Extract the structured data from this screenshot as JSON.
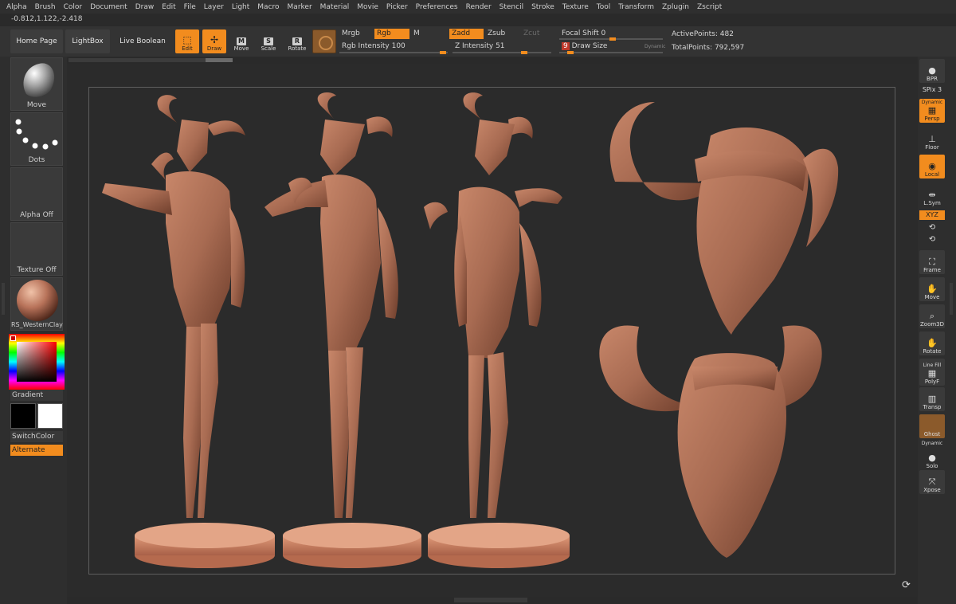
{
  "menu": [
    "Alpha",
    "Brush",
    "Color",
    "Document",
    "Draw",
    "Edit",
    "File",
    "Layer",
    "Light",
    "Macro",
    "Marker",
    "Material",
    "Movie",
    "Picker",
    "Preferences",
    "Render",
    "Stencil",
    "Stroke",
    "Texture",
    "Tool",
    "Transform",
    "Zplugin",
    "Zscript"
  ],
  "coords": "-0.812,1.122,-2.418",
  "shelf": {
    "home_page": "Home Page",
    "lightbox": "LightBox",
    "live_boolean": "Live Boolean",
    "edit": "Edit",
    "draw": "Draw",
    "move": "Move",
    "scale": "Scale",
    "rotate": "Rotate",
    "move_glyph": "M",
    "scale_glyph": "S",
    "rotate_glyph": "R",
    "mrgb": "Mrgb",
    "rgb": "Rgb",
    "m": "M",
    "zadd": "Zadd",
    "zsub": "Zsub",
    "zcut": "Zcut",
    "rgb_intensity_label": "Rgb Intensity",
    "rgb_intensity": "100",
    "z_intensity_label": "Z Intensity",
    "z_intensity": "51",
    "focal_shift_label": "Focal Shift",
    "focal_shift": "0",
    "draw_size_label": "Draw Size",
    "draw_size": "9",
    "dynamic": "Dynamic",
    "active_points": "ActivePoints: 482",
    "total_points": "TotalPoints: 792,597"
  },
  "left": {
    "brush": "Move",
    "stroke": "Dots",
    "alpha": "Alpha Off",
    "texture": "Texture Off",
    "material": "RS_WesternClay",
    "gradient": "Gradient",
    "switch_color": "SwitchColor",
    "alternate": "Alternate"
  },
  "right": {
    "bpr": "BPR",
    "spix": "SPix 3",
    "dynamic_top": "Dynamic",
    "persp": "Persp",
    "floor": "Floor",
    "local": "Local",
    "lsym": "L.Sym",
    "xyz": "XYZ",
    "frame": "Frame",
    "move": "Move",
    "zoom3d": "Zoom3D",
    "rotate": "Rotate",
    "line_fill": "Line Fill",
    "polyf": "PolyF",
    "transp": "Transp",
    "ghost": "Ghost",
    "dynamic_bottom": "Dynamic",
    "solo": "Solo",
    "xpose": "Xpose"
  },
  "colors": {
    "accent": "#f28c1e",
    "clay": "#a86b52",
    "background": "#2b2b2b"
  }
}
